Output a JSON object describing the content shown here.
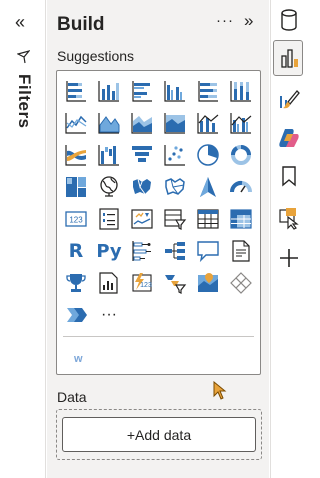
{
  "filters": {
    "collapse_glyph": "«",
    "label": "Filters"
  },
  "build": {
    "title": "Build",
    "more_glyph": "···",
    "expand_glyph": "»"
  },
  "suggestions": {
    "label": "Suggestions",
    "more_visuals_glyph": "···",
    "extra_glyph": "w"
  },
  "visuals": [
    "stacked-bar-chart-icon",
    "stacked-column-chart-icon",
    "clustered-bar-chart-icon",
    "clustered-column-chart-icon",
    "100-stacked-bar-chart-icon",
    "100-stacked-column-chart-icon",
    "line-chart-icon",
    "area-chart-icon",
    "stacked-area-chart-icon",
    "100-stacked-area-chart-icon",
    "line-stacked-column-chart-icon",
    "line-clustered-column-chart-icon",
    "ribbon-chart-icon",
    "waterfall-chart-icon",
    "funnel-chart-icon",
    "scatter-chart-icon",
    "pie-chart-icon",
    "donut-chart-icon",
    "treemap-icon",
    "map-icon",
    "filled-map-icon",
    "shape-map-icon",
    "azure-map-icon",
    "gauge-icon",
    "card-icon",
    "multi-row-card-icon",
    "kpi-icon",
    "slicer-icon",
    "table-icon",
    "matrix-icon",
    "r-visual-icon",
    "python-visual-icon",
    "key-influencers-icon",
    "decomposition-tree-icon",
    "qna-icon",
    "smart-narrative-icon",
    "goals-icon",
    "paginated-report-icon",
    "power-apps-icon",
    "power-automate-icon",
    "arcgis-map-icon",
    "get-more-visuals-icon",
    "power-bi-visual-icon",
    "more-visuals-icon"
  ],
  "visual_text": {
    "card": "123",
    "kpi": "123",
    "r": "R",
    "py": "Py"
  },
  "data": {
    "label": "Data",
    "add_button": "+Add data"
  },
  "rail": [
    "database-icon",
    "build-visual-icon",
    "format-brush-icon",
    "copilot-icon",
    "bookmark-icon",
    "selection-icon",
    "add-icon"
  ],
  "colors": {
    "accent_blue": "#2b6cb0",
    "light_blue": "#6fa8dc",
    "orange": "#e8a33b",
    "panel_bg": "#f3f2f1",
    "border": "#8a8886"
  }
}
